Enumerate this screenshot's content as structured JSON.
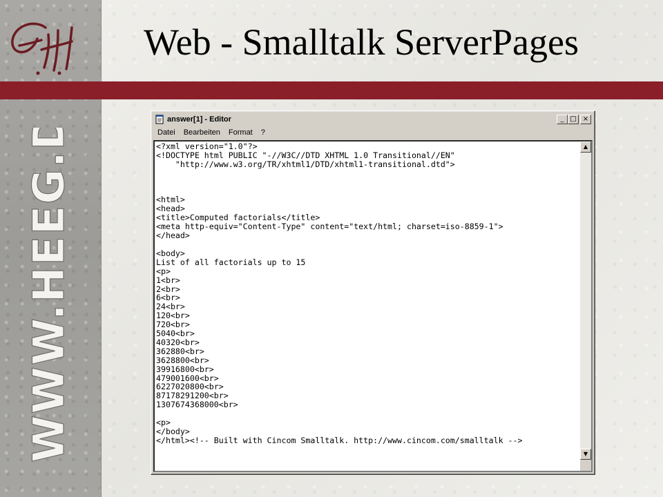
{
  "page": {
    "title": "Web - Smalltalk ServerPages",
    "logo_text": "G.H.",
    "sidebar_text": "WWW.HEEG.DE",
    "accent_color": "#8a1f2a"
  },
  "editor": {
    "window_title": "answer[1] - Editor",
    "icon": "notepad-icon",
    "buttons": {
      "minimize": "_",
      "maximize": "□",
      "close": "×"
    },
    "menu": [
      "Datei",
      "Bearbeiten",
      "Format",
      "?"
    ],
    "lines": [
      "<?xml version=\"1.0\"?>",
      "<!DOCTYPE html PUBLIC \"-//W3C//DTD XHTML 1.0 Transitional//EN\"",
      "    \"http://www.w3.org/TR/xhtml1/DTD/xhtml1-transitional.dtd\">",
      "",
      "",
      "",
      "<html>",
      "<head>",
      "<title>Computed factorials</title>",
      "<meta http-equiv=\"Content-Type\" content=\"text/html; charset=iso-8859-1\">",
      "</head>",
      "",
      "<body>",
      "List of all factorials up to 15",
      "<p>",
      "1<br>",
      "2<br>",
      "6<br>",
      "24<br>",
      "120<br>",
      "720<br>",
      "5040<br>",
      "40320<br>",
      "362880<br>",
      "3628800<br>",
      "39916800<br>",
      "479001600<br>",
      "6227020800<br>",
      "87178291200<br>",
      "1307674368000<br>",
      "",
      "<p>",
      "</body>",
      "</html><!-- Built with Cincom Smalltalk. http://www.cincom.com/smalltalk -->"
    ]
  }
}
